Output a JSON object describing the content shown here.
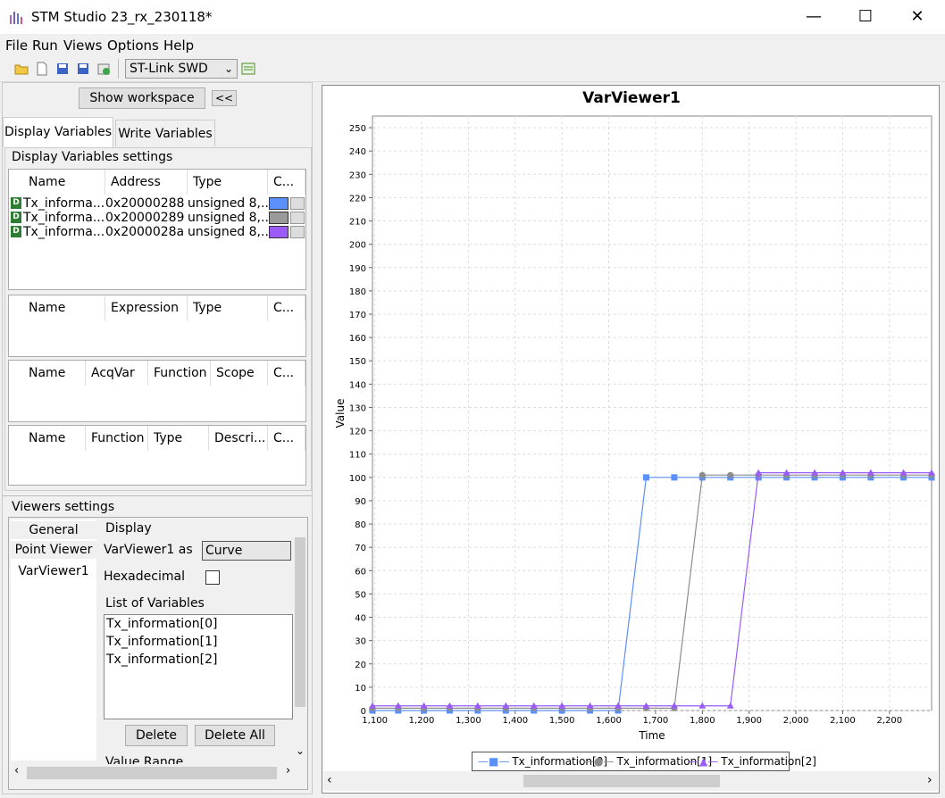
{
  "window": {
    "title": "STM Studio 23_rx_230118*",
    "minimize_glyph": "—",
    "maximize_glyph": "☐",
    "close_glyph": "✕"
  },
  "menu": [
    "File",
    "Run",
    "Views",
    "Options",
    "Help"
  ],
  "toolbar": {
    "icons": [
      "open-folder-icon",
      "new-file-icon",
      "save-all-icon",
      "save-icon",
      "export-icon"
    ],
    "connection": "ST-Link SWD"
  },
  "workspace": {
    "show_button": "Show workspace",
    "collapse_button": "<<",
    "tabs": [
      "Display Variables",
      "Write Variables"
    ],
    "settings_label": "Display Variables settings",
    "var_table": {
      "headers": [
        "Name",
        "Address",
        "Type",
        "C..."
      ],
      "rows": [
        {
          "name": "Tx_informa...",
          "address": "0x20000288",
          "type": "unsigned 8,...",
          "color": "#5b8ff9"
        },
        {
          "name": "Tx_informa...",
          "address": "0x20000289",
          "type": "unsigned 8,...",
          "color": "#9a9a9a"
        },
        {
          "name": "Tx_informa...",
          "address": "0x2000028a",
          "type": "unsigned 8,...",
          "color": "#9a5bf9"
        }
      ]
    },
    "expr_table": {
      "headers": [
        "Name",
        "Expression",
        "Type",
        "C..."
      ]
    },
    "func_table": {
      "headers": [
        "Name",
        "AcqVar",
        "Function",
        "Scope",
        "C..."
      ]
    },
    "misc_table": {
      "headers": [
        "Name",
        "Function",
        "Type",
        "Descri...",
        "C..."
      ]
    }
  },
  "viewers": {
    "label": "Viewers settings",
    "list": [
      "General",
      "Point Viewer",
      "VarViewer1"
    ],
    "display_label": "Display",
    "as_label": "VarViewer1 as",
    "as_value": "Curve",
    "hex_label": "Hexadecimal",
    "vars_label": "List of Variables",
    "vars": [
      "Tx_information[0]",
      "Tx_information[1]",
      "Tx_information[2]"
    ],
    "delete": "Delete",
    "delete_all": "Delete All",
    "range_label": "Value Range"
  },
  "chart_data": {
    "type": "line",
    "title": "VarViewer1",
    "xlabel": "Time",
    "ylabel": "Value",
    "xlim": [
      1095,
      2290
    ],
    "ylim": [
      0,
      255
    ],
    "x_ticks": [
      "1,100",
      "1,200",
      "1,300",
      "1,400",
      "1,500",
      "1,600",
      "1,700",
      "1,800",
      "1,900",
      "2,000",
      "2,100",
      "2,200"
    ],
    "x_tick_values": [
      1100,
      1200,
      1300,
      1400,
      1500,
      1600,
      1700,
      1800,
      1900,
      2000,
      2100,
      2200
    ],
    "y_ticks": [
      0,
      10,
      20,
      30,
      40,
      50,
      60,
      70,
      80,
      90,
      100,
      110,
      120,
      130,
      140,
      150,
      160,
      170,
      180,
      190,
      200,
      210,
      220,
      230,
      240,
      250
    ],
    "grid": true,
    "legend_position": "bottom",
    "series": [
      {
        "name": "Tx_information[0]",
        "color": "#5b8ff9",
        "marker": "square",
        "x": [
          1095,
          1150,
          1205,
          1260,
          1320,
          1380,
          1440,
          1500,
          1560,
          1620,
          1680,
          1740,
          1800,
          1860,
          1920,
          1980,
          2040,
          2100,
          2160,
          2230,
          2290
        ],
        "y": [
          0,
          0,
          0,
          0,
          0,
          0,
          0,
          0,
          0,
          0,
          100,
          100,
          100,
          100,
          100,
          100,
          100,
          100,
          100,
          100,
          100
        ]
      },
      {
        "name": "Tx_information[1]",
        "color": "#8c8c8c",
        "marker": "circle",
        "x": [
          1095,
          1150,
          1205,
          1260,
          1320,
          1380,
          1440,
          1500,
          1560,
          1620,
          1680,
          1740,
          1800,
          1860,
          1920,
          1980,
          2040,
          2100,
          2160,
          2230,
          2290
        ],
        "y": [
          1,
          1,
          1,
          1,
          1,
          1,
          1,
          1,
          1,
          1,
          1,
          1,
          101,
          101,
          101,
          101,
          101,
          101,
          101,
          101,
          101
        ]
      },
      {
        "name": "Tx_information[2]",
        "color": "#9a5bf9",
        "marker": "triangle",
        "x": [
          1095,
          1150,
          1205,
          1260,
          1320,
          1380,
          1440,
          1500,
          1560,
          1620,
          1680,
          1740,
          1800,
          1860,
          1920,
          1980,
          2040,
          2100,
          2160,
          2230,
          2290
        ],
        "y": [
          2,
          2,
          2,
          2,
          2,
          2,
          2,
          2,
          2,
          2,
          2,
          2,
          2,
          2,
          102,
          102,
          102,
          102,
          102,
          102,
          102
        ]
      }
    ]
  }
}
